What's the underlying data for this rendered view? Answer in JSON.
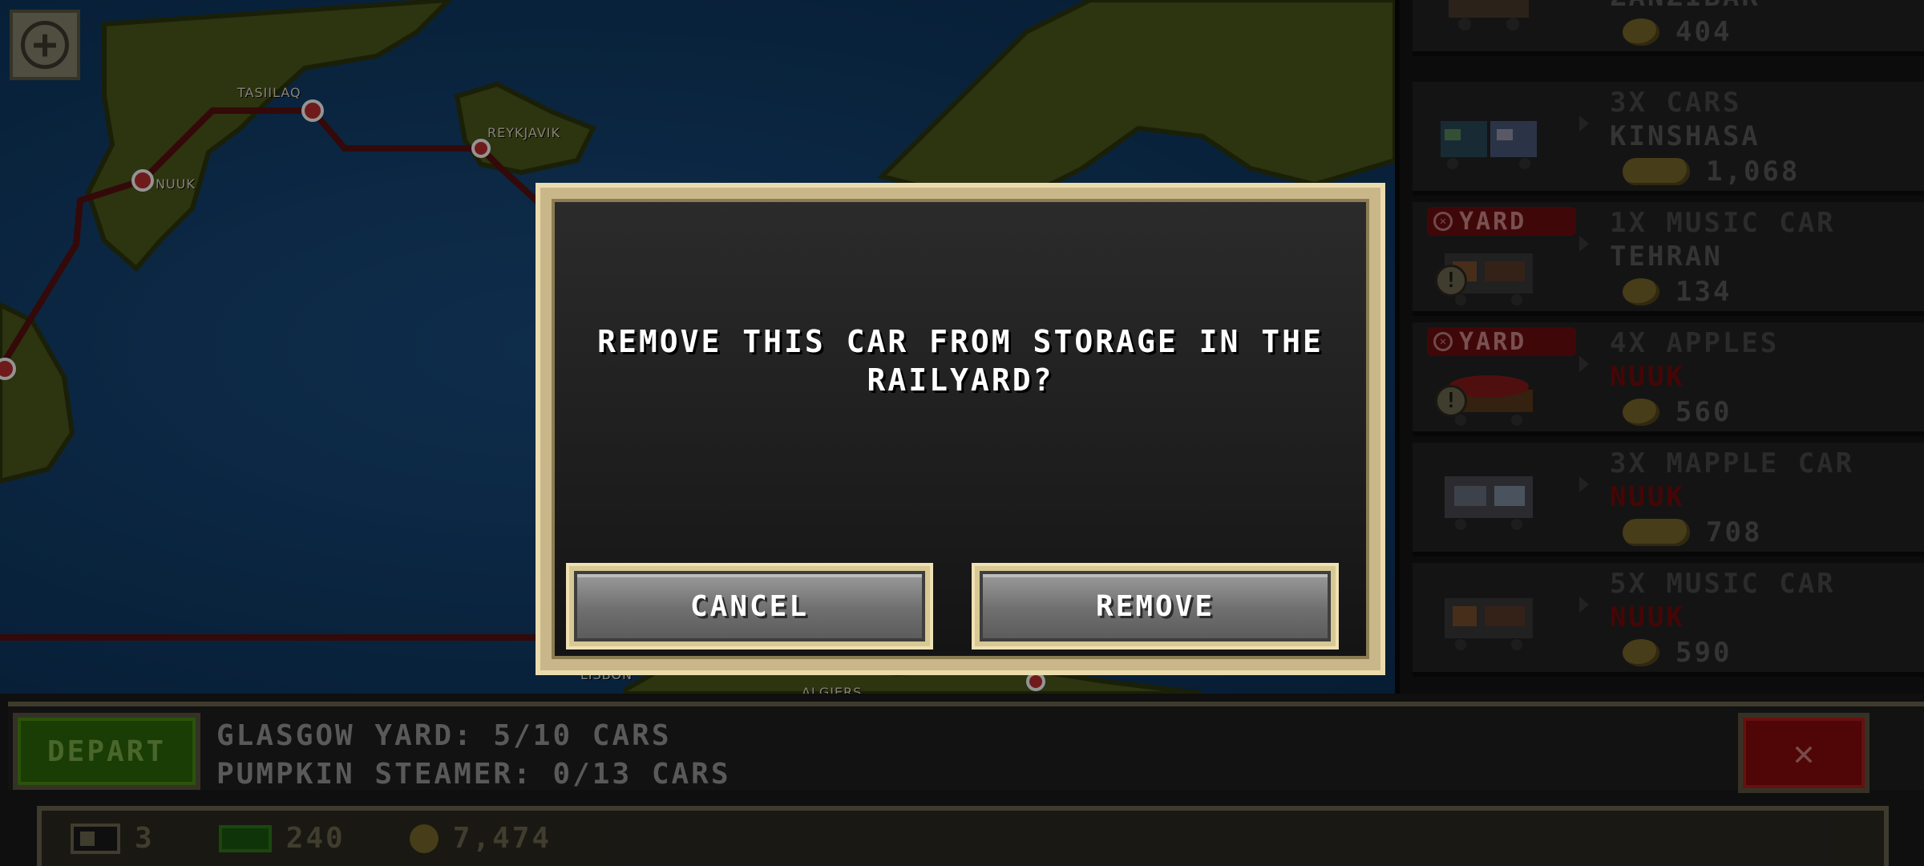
{
  "map": {
    "cities": [
      "TASIILAQ",
      "REYKJAVIK",
      "NUUK",
      "LISBON",
      "ALGIERS"
    ]
  },
  "railyard_list": [
    {
      "line1": "",
      "line2": "ZANZIBAR",
      "price": "404",
      "yard": false
    },
    {
      "line1": "3X CARS",
      "line2": "KINSHASA",
      "price": "1,068",
      "yard": false
    },
    {
      "line1": "1X MUSIC CAR",
      "line2": "TEHRAN",
      "price": "134",
      "yard": true
    },
    {
      "line1": "4X APPLES",
      "line2": "NUUK",
      "price": "560",
      "yard": true
    },
    {
      "line1": "3X MAPPLE CAR",
      "line2": "NUUK",
      "price": "708",
      "yard": false
    },
    {
      "line1": "5X MUSIC CAR",
      "line2": "NUUK",
      "price": "590",
      "yard": false
    }
  ],
  "yard_badge_label": "YARD",
  "bottom": {
    "depart_label": "DEPART",
    "yard_info": "GLASGOW YARD: 5/10 CARS",
    "train_info": "PUMPKIN STEAMER: 0/13 CARS",
    "close_label": "✕"
  },
  "status": {
    "trains": "3",
    "cash": "240",
    "coins": "7,474"
  },
  "dialog": {
    "message": "REMOVE THIS CAR FROM STORAGE IN THE RAILYARD?",
    "cancel_label": "CANCEL",
    "remove_label": "REMOVE"
  },
  "colors": {
    "dialog_border": "#c9b78a",
    "ocean": "#123f6d",
    "land": "#4d5a1c",
    "depart_green": "#2c6a0a",
    "close_red": "#8a0c0c"
  }
}
